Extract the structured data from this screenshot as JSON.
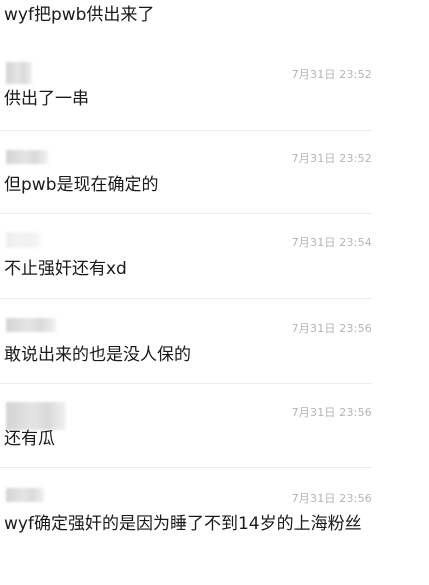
{
  "top_text": "wyf把pwb供出来了",
  "comments": [
    {
      "timestamp": "7月31日 23:52",
      "text": "供出了一串"
    },
    {
      "timestamp": "7月31日 23:52",
      "text": "但pwb是现在确定的"
    },
    {
      "timestamp": "7月31日 23:54",
      "text": "不止强奸还有xd"
    },
    {
      "timestamp": "7月31日 23:56",
      "text": "敢说出来的也是没人保的"
    },
    {
      "timestamp": "7月31日 23:56",
      "text": "还有瓜"
    },
    {
      "timestamp": "7月31日 23:56",
      "text": "wyf确定强奸的是因为睡了不到14岁的上海粉丝"
    }
  ]
}
